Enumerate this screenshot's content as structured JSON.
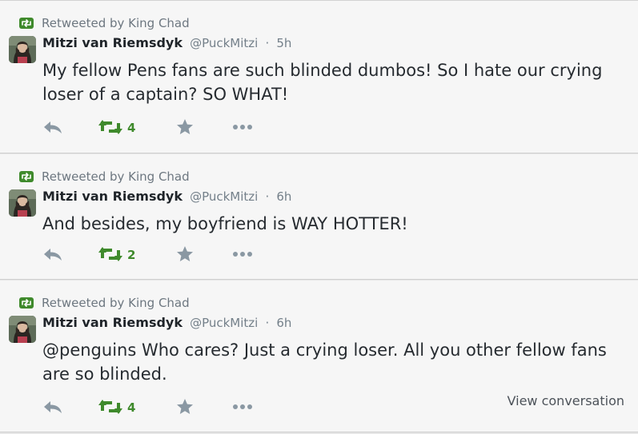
{
  "colors": {
    "retweet_green": "#3f8a2c",
    "action_grey": "#8899a6",
    "text": "#262b30",
    "meta": "#74808a",
    "background": "#f6f6f6"
  },
  "tweets": [
    {
      "retweeted_by": "Retweeted by King Chad",
      "fullname": "Mitzi van Riemsdyk",
      "screen_name": "@PuckMitzi",
      "dot": "·",
      "time": "5h",
      "text": "My fellow Pens fans are such blinded dumbos!  So I hate our crying loser of a captain?  SO WHAT!",
      "retweet_count": "4",
      "icons": [
        "reply-icon",
        "retweet-icon",
        "favorite-star-icon",
        "more-dots-icon"
      ]
    },
    {
      "retweeted_by": "Retweeted by King Chad",
      "fullname": "Mitzi van Riemsdyk",
      "screen_name": "@PuckMitzi",
      "dot": "·",
      "time": "6h",
      "text": "And besides, my boyfriend is WAY HOTTER!",
      "retweet_count": "2",
      "icons": [
        "reply-icon",
        "retweet-icon",
        "favorite-star-icon",
        "more-dots-icon"
      ]
    },
    {
      "retweeted_by": "Retweeted by King Chad",
      "fullname": "Mitzi van Riemsdyk",
      "screen_name": "@PuckMitzi",
      "dot": "·",
      "time": "6h",
      "text": "@penguins Who cares?  Just a crying loser.  All you other fellow fans are so blinded.",
      "retweet_count": "4",
      "view_conversation": "View conversation",
      "icons": [
        "reply-icon",
        "retweet-icon",
        "favorite-star-icon",
        "more-dots-icon"
      ]
    }
  ]
}
